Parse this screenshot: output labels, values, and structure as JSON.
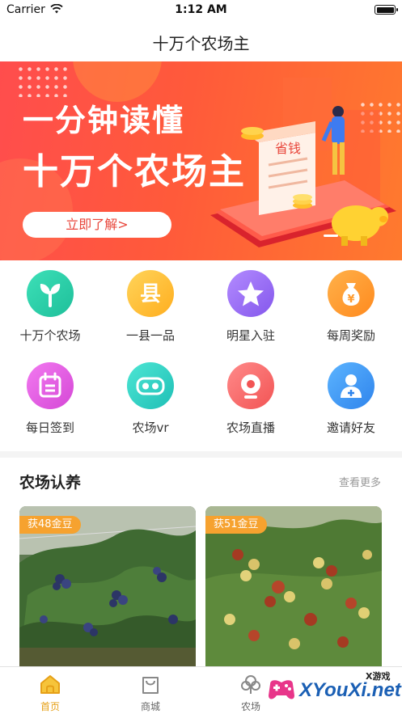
{
  "status_bar": {
    "carrier": "Carrier",
    "time": "1:12 AM"
  },
  "nav": {
    "title": "十万个农场主"
  },
  "banner": {
    "line1": "一分钟读懂",
    "line2": "十万个农场主",
    "button": "立即了解>",
    "receipt_text": "省钱"
  },
  "grid": {
    "items": [
      {
        "label": "十万个农场",
        "icon": "sprout-icon",
        "color": "#2fd1b0"
      },
      {
        "label": "一县一品",
        "icon": "county-icon",
        "color": "#ffc23a",
        "glyph": "县"
      },
      {
        "label": "明星入驻",
        "icon": "star-icon",
        "color": "#9a6df5"
      },
      {
        "label": "每周奖励",
        "icon": "money-bag-icon",
        "color": "#ff9b2e"
      },
      {
        "label": "每日签到",
        "icon": "calendar-icon",
        "color": "#e35de0"
      },
      {
        "label": "农场vr",
        "icon": "vr-icon",
        "color": "#2fd1c4"
      },
      {
        "label": "农场直播",
        "icon": "webcam-icon",
        "color": "#ff6a6a"
      },
      {
        "label": "邀请好友",
        "icon": "add-user-icon",
        "color": "#3f9af5"
      }
    ]
  },
  "adoption": {
    "title": "农场认养",
    "more": "查看更多",
    "cards": [
      {
        "badge": "获48金豆",
        "subject": "blueberry bush"
      },
      {
        "badge": "获51金豆",
        "subject": "jujube tree"
      }
    ]
  },
  "tabbar": {
    "tabs": [
      {
        "label": "首页",
        "icon": "home-icon",
        "active": true
      },
      {
        "label": "商城",
        "icon": "shopping-bag-icon",
        "active": false
      },
      {
        "label": "农场",
        "icon": "tree-icon",
        "active": false
      }
    ]
  },
  "watermark": {
    "brand": "XYouXi.net",
    "cn": "X游戏"
  },
  "colors": {
    "accent": "#e6a017",
    "banner_red": "#ff4d4d",
    "badge": "#f6a22f"
  }
}
